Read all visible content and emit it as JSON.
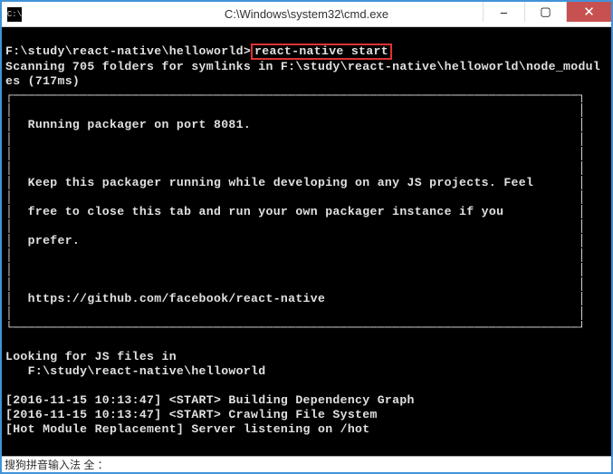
{
  "window": {
    "title": "C:\\Windows\\system32\\cmd.exe",
    "icon_label": "cmd"
  },
  "controls": {
    "minimize": "–",
    "maximize": "▢",
    "close": "✕"
  },
  "prompt": {
    "path": "F:\\study\\react-native\\helloworld>",
    "command": "react-native start"
  },
  "lines": {
    "scan": "Scanning 705 folders for symlinks in F:\\study\\react-native\\helloworld\\node_modul",
    "scan2": "es (717ms)",
    "border_top": "┌────────────────────────────────────────────────────────────────────────────┐",
    "run": "│  Running packager on port 8081.                                            │",
    "blank": "│                                                                            │",
    "keep": "│  Keep this packager running while developing on any JS projects. Feel      │",
    "free": "│  free to close this tab and run your own packager instance if you          │",
    "prefer": "│  prefer.                                                                   │",
    "url": "│  https://github.com/facebook/react-native                                  │",
    "border_bottom": "└────────────────────────────────────────────────────────────────────────────┘",
    "looking": "Looking for JS files in",
    "jsdir": "   F:\\study\\react-native\\helloworld",
    "ts1": "[2016-11-15 10:13:47] <START> Building Dependency Graph",
    "ts2": "[2016-11-15 10:13:47] <START> Crawling File System",
    "hot": "[Hot Module Replacement] Server listening on /hot"
  },
  "ime": "搜狗拼音输入法 全 ："
}
